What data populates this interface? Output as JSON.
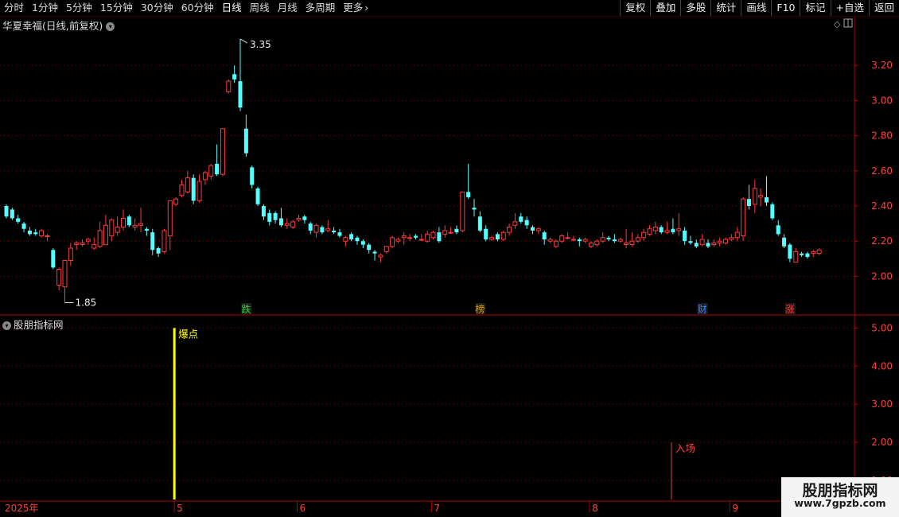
{
  "toolbar": {
    "periods": [
      "分时",
      "1分钟",
      "5分钟",
      "15分钟",
      "30分钟",
      "60分钟",
      "日线",
      "周线",
      "月线",
      "多周期",
      "更多"
    ],
    "active_period": "日线",
    "more_icon": "chevron-right-icon",
    "tools": [
      "复权",
      "叠加",
      "多股",
      "统计",
      "画线",
      "F10",
      "标记",
      "+自选",
      "返回"
    ]
  },
  "stock": {
    "title": "华夏幸福(日线,前复权)"
  },
  "indicator": {
    "title": "股朋指标网"
  },
  "watermark": {
    "name": "股朋指标网",
    "url": "www.7gpzb.com"
  },
  "colors": {
    "up": "#ff3a3a",
    "down": "#54ffff",
    "grid": "#8c0000",
    "signal": "#ffff00",
    "entry": "#ff3a3a"
  },
  "chart_data": [
    {
      "type": "candlestick",
      "title": "华夏幸福(日线,前复权)",
      "ylim": [
        1.78,
        3.4
      ],
      "yticks": [
        "2.00",
        "2.20",
        "2.40",
        "2.60",
        "2.80",
        "3.00",
        "3.20"
      ],
      "x_labels": [
        {
          "i": 0,
          "label": "2025年"
        },
        {
          "i": 29,
          "label": "5"
        },
        {
          "i": 50,
          "label": "6"
        },
        {
          "i": 73,
          "label": "7"
        },
        {
          "i": 100,
          "label": "8"
        },
        {
          "i": 124,
          "label": "9"
        }
      ],
      "max_annotation": {
        "i": 40,
        "label": "3.35"
      },
      "min_annotation": {
        "i": 10,
        "label": "1.85"
      },
      "markers": [
        {
          "i": 41,
          "label": "跌",
          "color": "#30d030"
        },
        {
          "i": 81,
          "label": "榜",
          "color": "#e0a000"
        },
        {
          "i": 119,
          "label": "财",
          "color": "#3a80ff"
        },
        {
          "i": 134,
          "label": "涨",
          "color": "#ff3a3a"
        }
      ],
      "ohlc": [
        [
          2.4,
          2.41,
          2.33,
          2.34
        ],
        [
          2.38,
          2.39,
          2.32,
          2.33
        ],
        [
          2.33,
          2.35,
          2.3,
          2.31
        ],
        [
          2.3,
          2.31,
          2.25,
          2.27
        ],
        [
          2.26,
          2.28,
          2.23,
          2.24
        ],
        [
          2.25,
          2.27,
          2.23,
          2.24
        ],
        [
          2.23,
          2.27,
          2.22,
          2.26
        ],
        [
          2.23,
          2.24,
          2.2,
          2.23
        ],
        [
          2.15,
          2.16,
          2.04,
          2.05
        ],
        [
          1.95,
          2.05,
          1.92,
          2.04
        ],
        [
          1.94,
          2.09,
          1.85,
          2.09
        ],
        [
          2.09,
          2.19,
          2.06,
          2.16
        ],
        [
          2.18,
          2.2,
          2.15,
          2.19
        ],
        [
          2.18,
          2.21,
          2.17,
          2.19
        ],
        [
          2.2,
          2.22,
          2.18,
          2.21
        ],
        [
          2.16,
          2.22,
          2.15,
          2.18
        ],
        [
          2.17,
          2.31,
          2.16,
          2.26
        ],
        [
          2.18,
          2.35,
          2.18,
          2.29
        ],
        [
          2.23,
          2.33,
          2.2,
          2.32
        ],
        [
          2.25,
          2.34,
          2.23,
          2.28
        ],
        [
          2.28,
          2.38,
          2.26,
          2.33
        ],
        [
          2.34,
          2.35,
          2.28,
          2.29
        ],
        [
          2.28,
          2.33,
          2.26,
          2.29
        ],
        [
          2.29,
          2.39,
          2.25,
          2.3
        ],
        [
          2.27,
          2.28,
          2.23,
          2.26
        ],
        [
          2.25,
          2.27,
          2.12,
          2.15
        ],
        [
          2.16,
          2.17,
          2.11,
          2.13
        ],
        [
          2.14,
          2.27,
          2.13,
          2.26
        ],
        [
          2.23,
          2.39,
          2.15,
          2.43
        ],
        [
          2.41,
          2.45,
          2.4,
          2.44
        ],
        [
          2.46,
          2.55,
          2.45,
          2.52
        ],
        [
          2.48,
          2.6,
          2.47,
          2.56
        ],
        [
          2.56,
          2.58,
          2.41,
          2.43
        ],
        [
          2.43,
          2.58,
          2.42,
          2.54
        ],
        [
          2.55,
          2.6,
          2.52,
          2.59
        ],
        [
          2.57,
          2.64,
          2.55,
          2.63
        ],
        [
          2.64,
          2.75,
          2.57,
          2.58
        ],
        [
          2.58,
          2.84,
          2.57,
          2.84
        ],
        [
          3.05,
          3.12,
          3.04,
          3.11
        ],
        [
          3.15,
          3.2,
          3.1,
          3.12
        ],
        [
          3.11,
          3.35,
          2.94,
          2.96
        ],
        [
          2.84,
          2.92,
          2.68,
          2.7
        ],
        [
          2.62,
          2.63,
          2.5,
          2.52
        ],
        [
          2.5,
          2.51,
          2.4,
          2.41
        ],
        [
          2.4,
          2.41,
          2.32,
          2.34
        ],
        [
          2.36,
          2.38,
          2.29,
          2.31
        ],
        [
          2.36,
          2.37,
          2.3,
          2.32
        ],
        [
          2.33,
          2.39,
          2.28,
          2.29
        ],
        [
          2.29,
          2.33,
          2.27,
          2.3
        ],
        [
          2.28,
          2.32,
          2.27,
          2.31
        ],
        [
          2.32,
          2.35,
          2.31,
          2.33
        ],
        [
          2.34,
          2.35,
          2.3,
          2.32
        ],
        [
          2.3,
          2.31,
          2.24,
          2.26
        ],
        [
          2.25,
          2.3,
          2.22,
          2.29
        ],
        [
          2.28,
          2.29,
          2.24,
          2.25
        ],
        [
          2.26,
          2.32,
          2.25,
          2.27
        ],
        [
          2.26,
          2.28,
          2.24,
          2.25
        ],
        [
          2.25,
          2.27,
          2.22,
          2.23
        ],
        [
          2.2,
          2.23,
          2.17,
          2.22
        ],
        [
          2.24,
          2.25,
          2.2,
          2.21
        ],
        [
          2.22,
          2.23,
          2.18,
          2.2
        ],
        [
          2.2,
          2.21,
          2.16,
          2.18
        ],
        [
          2.18,
          2.19,
          2.13,
          2.15
        ],
        [
          2.14,
          2.15,
          2.09,
          2.13
        ],
        [
          2.11,
          2.13,
          2.08,
          2.12
        ],
        [
          2.14,
          2.17,
          2.13,
          2.17
        ],
        [
          2.17,
          2.23,
          2.16,
          2.22
        ],
        [
          2.2,
          2.22,
          2.19,
          2.21
        ],
        [
          2.22,
          2.25,
          2.18,
          2.23
        ],
        [
          2.22,
          2.24,
          2.2,
          2.22
        ],
        [
          2.23,
          2.24,
          2.21,
          2.22
        ],
        [
          2.21,
          2.24,
          2.2,
          2.21
        ],
        [
          2.2,
          2.26,
          2.19,
          2.24
        ],
        [
          2.22,
          2.26,
          2.21,
          2.25
        ],
        [
          2.25,
          2.28,
          2.19,
          2.2
        ],
        [
          2.24,
          2.29,
          2.22,
          2.26
        ],
        [
          2.25,
          2.28,
          2.24,
          2.25
        ],
        [
          2.27,
          2.29,
          2.24,
          2.25
        ],
        [
          2.26,
          2.48,
          2.25,
          2.48
        ],
        [
          2.48,
          2.64,
          2.44,
          2.45
        ],
        [
          2.39,
          2.44,
          2.34,
          2.38
        ],
        [
          2.34,
          2.37,
          2.25,
          2.26
        ],
        [
          2.27,
          2.29,
          2.2,
          2.21
        ],
        [
          2.21,
          2.23,
          2.2,
          2.22
        ],
        [
          2.24,
          2.25,
          2.2,
          2.21
        ],
        [
          2.21,
          2.26,
          2.2,
          2.25
        ],
        [
          2.25,
          2.3,
          2.23,
          2.28
        ],
        [
          2.29,
          2.36,
          2.27,
          2.31
        ],
        [
          2.34,
          2.36,
          2.3,
          2.31
        ],
        [
          2.32,
          2.34,
          2.27,
          2.29
        ],
        [
          2.28,
          2.29,
          2.24,
          2.26
        ],
        [
          2.26,
          2.28,
          2.24,
          2.27
        ],
        [
          2.25,
          2.26,
          2.18,
          2.21
        ],
        [
          2.2,
          2.22,
          2.19,
          2.21
        ],
        [
          2.17,
          2.21,
          2.16,
          2.2
        ],
        [
          2.2,
          2.24,
          2.19,
          2.23
        ],
        [
          2.22,
          2.25,
          2.21,
          2.22
        ],
        [
          2.21,
          2.23,
          2.2,
          2.21
        ],
        [
          2.21,
          2.22,
          2.17,
          2.2
        ],
        [
          2.2,
          2.22,
          2.19,
          2.21
        ],
        [
          2.17,
          2.2,
          2.16,
          2.19
        ],
        [
          2.18,
          2.21,
          2.17,
          2.2
        ],
        [
          2.2,
          2.25,
          2.19,
          2.22
        ],
        [
          2.22,
          2.23,
          2.2,
          2.21
        ],
        [
          2.21,
          2.24,
          2.19,
          2.2
        ],
        [
          2.2,
          2.22,
          2.19,
          2.21
        ],
        [
          2.18,
          2.27,
          2.16,
          2.19
        ],
        [
          2.18,
          2.25,
          2.17,
          2.2
        ],
        [
          2.2,
          2.24,
          2.19,
          2.22
        ],
        [
          2.22,
          2.27,
          2.2,
          2.25
        ],
        [
          2.24,
          2.29,
          2.23,
          2.27
        ],
        [
          2.26,
          2.31,
          2.24,
          2.28
        ],
        [
          2.28,
          2.29,
          2.24,
          2.25
        ],
        [
          2.25,
          2.31,
          2.24,
          2.26
        ],
        [
          2.27,
          2.33,
          2.24,
          2.25
        ],
        [
          2.26,
          2.36,
          2.23,
          2.27
        ],
        [
          2.26,
          2.28,
          2.18,
          2.2
        ],
        [
          2.2,
          2.23,
          2.18,
          2.19
        ],
        [
          2.19,
          2.21,
          2.16,
          2.17
        ],
        [
          2.18,
          2.24,
          2.17,
          2.21
        ],
        [
          2.19,
          2.21,
          2.16,
          2.17
        ],
        [
          2.18,
          2.21,
          2.17,
          2.19
        ],
        [
          2.19,
          2.22,
          2.17,
          2.2
        ],
        [
          2.19,
          2.22,
          2.18,
          2.21
        ],
        [
          2.21,
          2.24,
          2.2,
          2.22
        ],
        [
          2.22,
          2.28,
          2.2,
          2.25
        ],
        [
          2.23,
          2.45,
          2.2,
          2.44
        ],
        [
          2.44,
          2.52,
          2.38,
          2.4
        ],
        [
          2.41,
          2.55,
          2.36,
          2.5
        ],
        [
          2.45,
          2.5,
          2.4,
          2.46
        ],
        [
          2.45,
          2.57,
          2.4,
          2.42
        ],
        [
          2.41,
          2.42,
          2.32,
          2.33
        ],
        [
          2.29,
          2.32,
          2.23,
          2.24
        ],
        [
          2.22,
          2.24,
          2.16,
          2.17
        ],
        [
          2.18,
          2.19,
          2.08,
          2.1
        ],
        [
          2.08,
          2.16,
          2.08,
          2.14
        ],
        [
          2.13,
          2.14,
          2.11,
          2.12
        ],
        [
          2.13,
          2.14,
          2.1,
          2.11
        ],
        [
          2.13,
          2.15,
          2.11,
          2.14
        ],
        [
          2.13,
          2.16,
          2.12,
          2.15
        ]
      ]
    },
    {
      "type": "indicator",
      "title": "股朋指标网",
      "ylim": [
        0.5,
        5.3
      ],
      "yticks": [
        "1.00",
        "2.00",
        "3.00",
        "4.00",
        "5.00"
      ],
      "signals": [
        {
          "i": 29,
          "value": 5.0,
          "label": "爆点",
          "color": "#ffff00",
          "width": 3
        },
        {
          "i": 114,
          "value": 2.0,
          "label": "入场",
          "color": "#ff3a3a",
          "width": 1
        }
      ]
    }
  ]
}
